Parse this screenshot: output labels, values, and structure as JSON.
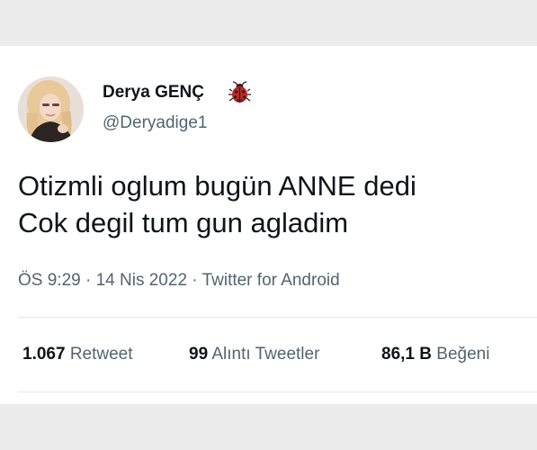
{
  "tweet": {
    "author": {
      "display_name": "Derya GENÇ",
      "handle": "@Deryadige1",
      "emoji_icon": "ladybug-icon",
      "avatar_icon": "profile-photo"
    },
    "text_lines": [
      "Otizmli oglum bugün ANNE dedi",
      "Cok degil tum gun agladim"
    ],
    "meta": {
      "time": "ÖS 9:29",
      "separator": "·",
      "date": "14 Nis 2022",
      "source": "Twitter for Android"
    },
    "stats": {
      "retweets": {
        "count": "1.067",
        "label": "Retweet"
      },
      "quotes": {
        "count": "99",
        "label": "Alıntı Tweetler"
      },
      "likes": {
        "count": "86,1 B",
        "label": "Beğeni"
      }
    }
  },
  "colors": {
    "text_primary": "#0f1419",
    "text_secondary": "#536471",
    "divider": "#e4e8eb",
    "background_outer": "#ececec",
    "card_background": "#ffffff",
    "ladybug_red": "#c0272d"
  }
}
